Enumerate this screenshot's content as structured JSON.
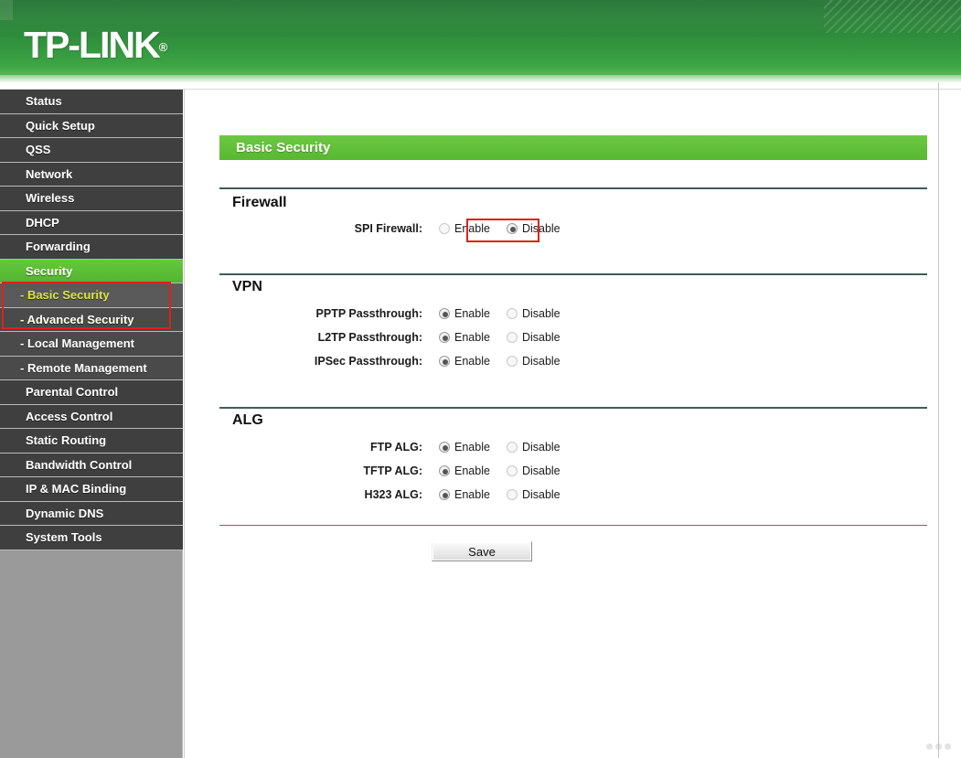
{
  "brand": {
    "logo_text": "TP-LINK",
    "registered_mark": "®"
  },
  "sidebar": {
    "items": [
      {
        "label": "Status",
        "level": "top",
        "state": "normal"
      },
      {
        "label": "Quick Setup",
        "level": "top",
        "state": "normal"
      },
      {
        "label": "QSS",
        "level": "top",
        "state": "normal"
      },
      {
        "label": "Network",
        "level": "top",
        "state": "normal"
      },
      {
        "label": "Wireless",
        "level": "top",
        "state": "normal"
      },
      {
        "label": "DHCP",
        "level": "top",
        "state": "normal"
      },
      {
        "label": "Forwarding",
        "level": "top",
        "state": "normal"
      },
      {
        "label": "Security",
        "level": "top",
        "state": "active"
      },
      {
        "label": "- Basic Security",
        "level": "sub",
        "state": "subactive"
      },
      {
        "label": "- Advanced Security",
        "level": "sub",
        "state": "normal"
      },
      {
        "label": "- Local Management",
        "level": "sub",
        "state": "normal"
      },
      {
        "label": "- Remote Management",
        "level": "sub",
        "state": "normal"
      },
      {
        "label": "Parental Control",
        "level": "top",
        "state": "normal"
      },
      {
        "label": "Access Control",
        "level": "top",
        "state": "normal"
      },
      {
        "label": "Static Routing",
        "level": "top",
        "state": "normal"
      },
      {
        "label": "Bandwidth Control",
        "level": "top",
        "state": "normal"
      },
      {
        "label": "IP & MAC Binding",
        "level": "top",
        "state": "normal"
      },
      {
        "label": "Dynamic DNS",
        "level": "top",
        "state": "normal"
      },
      {
        "label": "System Tools",
        "level": "top",
        "state": "normal"
      }
    ]
  },
  "page": {
    "title": "Basic Security"
  },
  "sections": {
    "firewall": {
      "heading": "Firewall",
      "rows": [
        {
          "label": "SPI Firewall:",
          "enable_label": "Enable",
          "disable_label": "Disable",
          "selected": "disable"
        }
      ]
    },
    "vpn": {
      "heading": "VPN",
      "rows": [
        {
          "label": "PPTP Passthrough:",
          "enable_label": "Enable",
          "disable_label": "Disable",
          "selected": "enable"
        },
        {
          "label": "L2TP Passthrough:",
          "enable_label": "Enable",
          "disable_label": "Disable",
          "selected": "enable"
        },
        {
          "label": "IPSec Passthrough:",
          "enable_label": "Enable",
          "disable_label": "Disable",
          "selected": "enable"
        }
      ]
    },
    "alg": {
      "heading": "ALG",
      "rows": [
        {
          "label": "FTP ALG:",
          "enable_label": "Enable",
          "disable_label": "Disable",
          "selected": "enable"
        },
        {
          "label": "TFTP ALG:",
          "enable_label": "Enable",
          "disable_label": "Disable",
          "selected": "enable"
        },
        {
          "label": "H323 ALG:",
          "enable_label": "Enable",
          "disable_label": "Disable",
          "selected": "enable"
        }
      ]
    }
  },
  "actions": {
    "save_label": "Save"
  },
  "colors": {
    "header_green": "#2f8b3d",
    "accent_green": "#5cbf36",
    "title_bar_green": "#63c13a",
    "menu_dark": "#3f3f3f",
    "sidebar_bg": "#9a9a9a",
    "annotation_red": "#e02020",
    "sub_active_text": "#d9e63c",
    "divider": "#3f5d57"
  }
}
